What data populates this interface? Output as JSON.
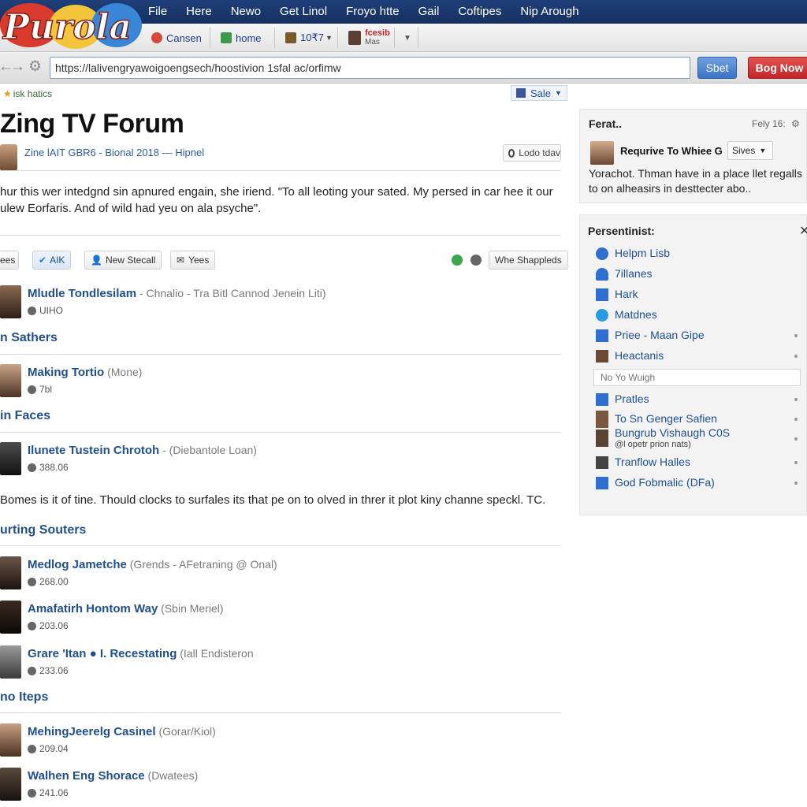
{
  "menu": {
    "items": [
      "File",
      "Here",
      "Newo",
      "Get Linol",
      "Froyo htte",
      "Gail",
      "Coftipes",
      "Nip Arough"
    ]
  },
  "logo": {
    "text": "Purola"
  },
  "bookmarks": {
    "items": [
      {
        "label": "Cansen",
        "icon": "user-icon"
      },
      {
        "label": "home",
        "icon": "home-icon"
      },
      {
        "label": "10₹7",
        "icon": "image-icon"
      },
      {
        "label_top": "fcesib",
        "label_bottom": "Mas",
        "icon": "avatar-icon"
      }
    ]
  },
  "address": {
    "url": "https://lalivengryawoigoengsech/hoostivion 1sfal ac/orfimw",
    "start_label": "Sbet",
    "book_label": "Bog Now"
  },
  "subrow": {
    "link": "isk hatics",
    "sale_label": "Sale"
  },
  "forum": {
    "title": "Zing TV Forum",
    "byline": "Zine lAIT GBR6 - Bional 2018 — Hipnel",
    "lodo_label": "Lodo tdav",
    "intro": "hur this wer intedgnd sin apnured engain, she iriend. \"To all leoting your sated. My persed in car hee it our ulew Eorfaris. And of wild had yeu on ala psyche\".",
    "actions": {
      "share": "ees",
      "alk": "AIK",
      "new_stecall": "New Stecall",
      "yees": "Yees",
      "shappleds": "Whe Shappleds"
    }
  },
  "threads": [
    {
      "title": "Mludle Tondlesilam",
      "meta": " - Chnalio - Tra Bitl Cannod Jenein Liti)",
      "count": "UIHO"
    },
    {
      "title": "Making Tortio",
      "meta": " (Mone)",
      "count": "7bl"
    },
    {
      "title": "Ilunete Tustein Chrotoh",
      "meta": " - (Diebantole Loan)",
      "count": "388.06"
    },
    {
      "title": "Medlog Jametche",
      "meta": " (Grends - AFetraning @ Onal)",
      "count": "268.00"
    },
    {
      "title": "Amafatirh Hontom Way",
      "meta": " (Sbin Meriel)",
      "count": "203.06"
    },
    {
      "title": "Grare 'Itan ● I. Recestating",
      "meta": " (Iall Endisteron",
      "count": "233.06"
    },
    {
      "title": "MehingJeerelg Casinel",
      "meta": " (Gorar/Kiol)",
      "count": "209.04"
    },
    {
      "title": "Walhen Eng Shorace",
      "meta": " (Dwatees)",
      "count": "241.06"
    }
  ],
  "sections": {
    "s1": "n Sathers",
    "s2": "in Faces",
    "s3": "urting Souters",
    "s4": "no Iteps"
  },
  "paragraph2": "Bomes is it of tine. Thould clocks to surfales its that pe on to olved in threr it plot kiny channe speckl. TC.",
  "featured": {
    "title": "Ferat..",
    "meta": "Fely 16:",
    "user": "Requrive To Whiee G",
    "dropdown": "Sives",
    "text": "Yorachot. Thman have in a place llet regalls to on alheasirs in desttecter abo.."
  },
  "persist": {
    "title": "Persentinist:",
    "items": [
      {
        "label": "Helpm Lisb",
        "icon": "info-icon"
      },
      {
        "label": "7illanes",
        "icon": "person-icon"
      },
      {
        "label": "Hark",
        "icon": "tag-icon"
      },
      {
        "label": "Matdnes",
        "icon": "bird-icon"
      },
      {
        "label": "Priee - Maan Gipe",
        "icon": "folder-icon"
      },
      {
        "label": "Heactanis",
        "icon": "photo-icon"
      }
    ],
    "filter_placeholder": "No Yo Wuigh",
    "items2": [
      {
        "label": "Pratles",
        "icon": "grid-icon"
      },
      {
        "label": "To Sn Genger Safien",
        "icon": "avatar-icon"
      },
      {
        "label": "Bungrub Vishaugh C0S",
        "sub": "@l opetr prion nats)",
        "icon": "avatar-icon"
      },
      {
        "label": "Tranflow Halles",
        "icon": "flag-icon"
      },
      {
        "label": "God Fobmalic (DFa)",
        "icon": "doc-icon"
      }
    ]
  },
  "colors": {
    "menubar": "#1f3f7a",
    "link": "#1f4f8f",
    "accent_red": "#c22525",
    "accent_blue": "#3b73c5"
  }
}
